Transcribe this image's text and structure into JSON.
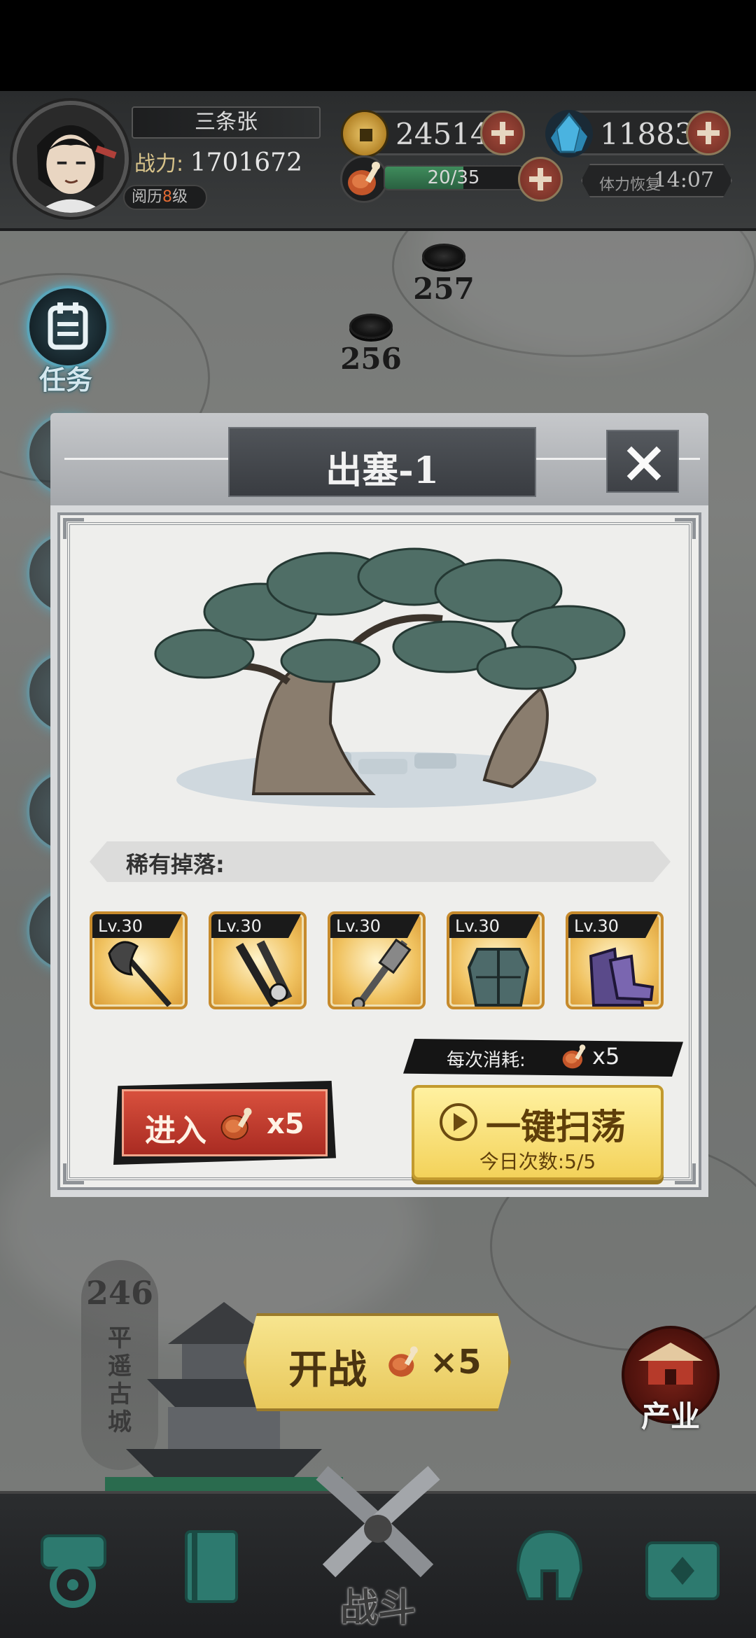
{
  "hud": {
    "player_name": "三条张",
    "power_label": "战力:",
    "power_value": "1701672",
    "experience_label": "阅历",
    "experience_level": "8",
    "experience_suffix": "级",
    "coins": "24514",
    "gems": "11883",
    "stamina_text": "20/35",
    "stamina_fraction": 0.57,
    "recover_label": "体力恢复",
    "recover_time": "14:07"
  },
  "map": {
    "stage_upper": "257",
    "stage_mid": "256",
    "stage_current": "246",
    "city_name": "平遥古城",
    "battle_label": "开战",
    "battle_cost": "×5",
    "industry_label": "产业"
  },
  "side_menu": {
    "task_label": "任务"
  },
  "modal": {
    "title": "出塞-1",
    "drops_label": "稀有掉落:",
    "items": [
      {
        "level": "Lv.30",
        "icon": "axe-icon"
      },
      {
        "level": "Lv.30",
        "icon": "twin-daggers-icon"
      },
      {
        "level": "Lv.30",
        "icon": "mace-icon"
      },
      {
        "level": "Lv.30",
        "icon": "armor-icon"
      },
      {
        "level": "Lv.30",
        "icon": "boots-icon"
      }
    ],
    "cost_label": "每次消耗:",
    "cost_amount": "x5",
    "enter_label": "进入",
    "enter_cost": "x5",
    "sweep_label": "一键扫荡",
    "sweep_count": "今日次数:5/5"
  },
  "nav": {
    "center_label": "战斗"
  },
  "colors": {
    "accent_red": "#c43c2e",
    "accent_gold": "#f3d25a",
    "stamina_green": "#3f8c5c"
  }
}
